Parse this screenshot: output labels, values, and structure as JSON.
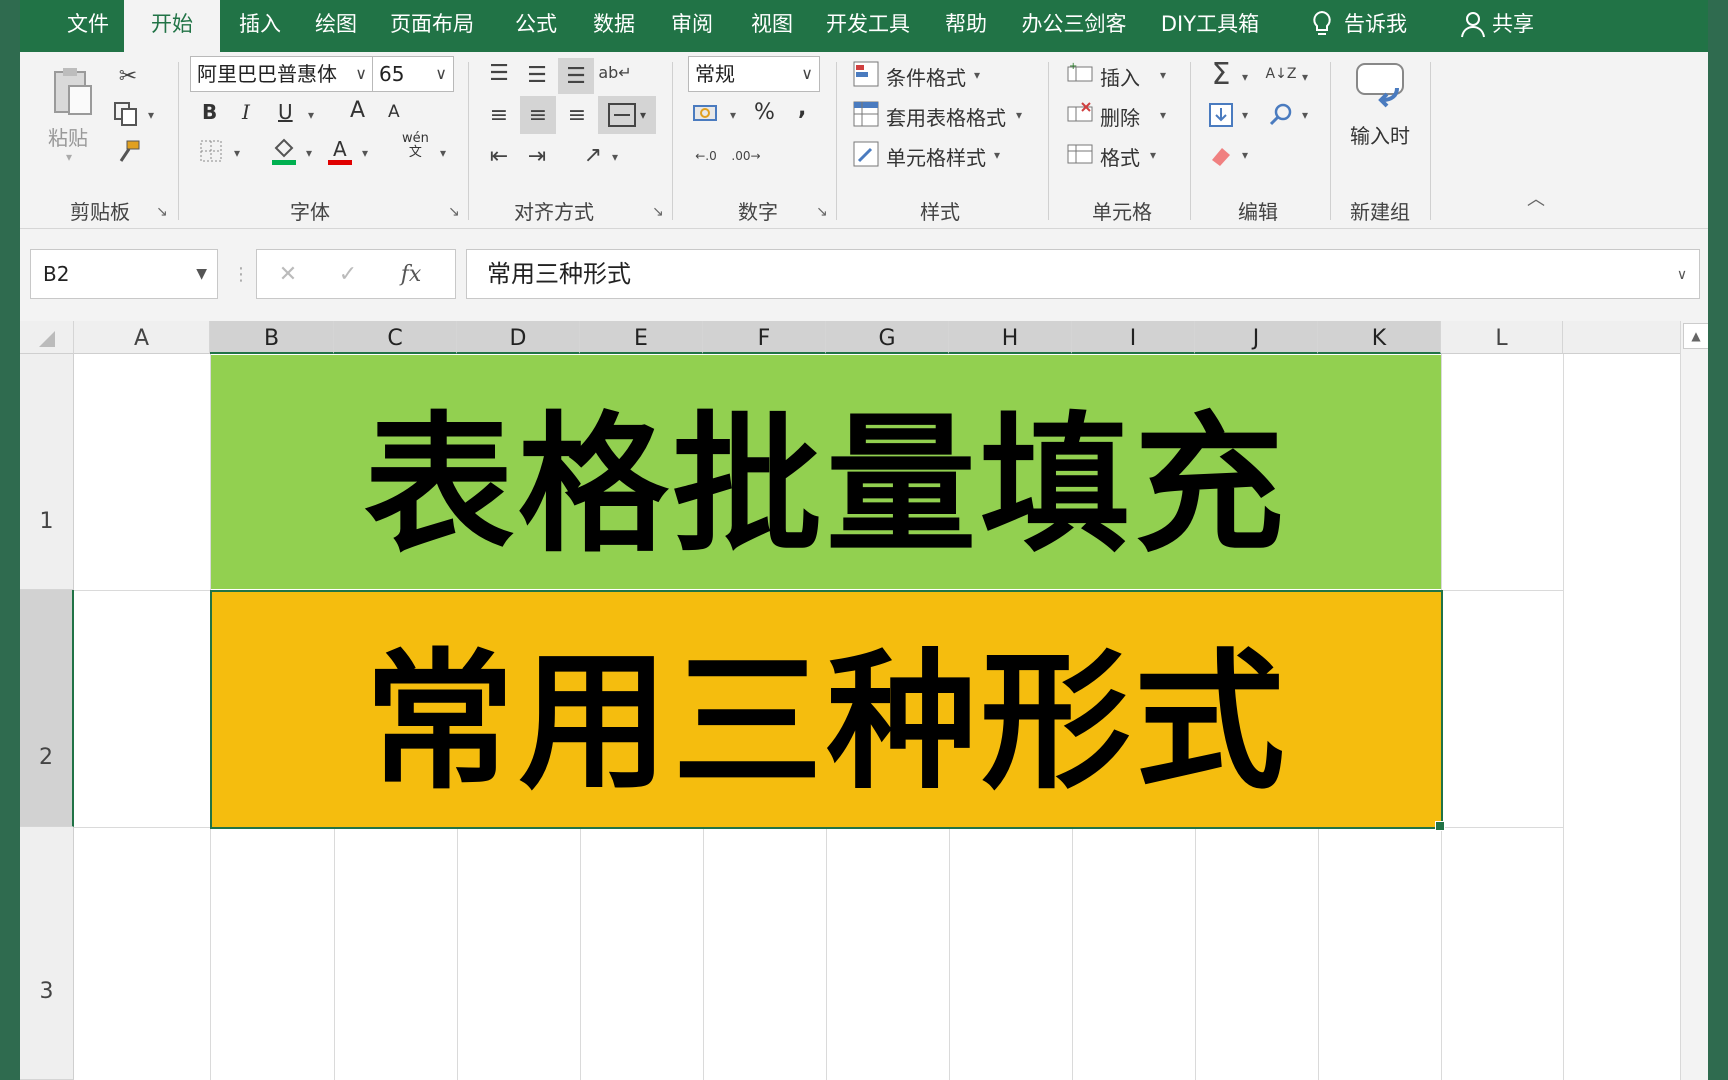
{
  "tabs": [
    "文件",
    "开始",
    "插入",
    "绘图",
    "页面布局",
    "公式",
    "数据",
    "审阅",
    "视图",
    "开发工具",
    "帮助",
    "办公三剑客",
    "DIY工具箱"
  ],
  "tell_me": "告诉我",
  "share": "共享",
  "ribbon": {
    "clipboard": {
      "label": "剪贴板",
      "paste": "粘贴"
    },
    "font": {
      "label": "字体",
      "font_name": "阿里巴巴普惠体",
      "font_size": "65",
      "bold": "B",
      "italic": "I",
      "underline": "U",
      "grow": "A",
      "shrink": "A",
      "phonetic_top": "wén",
      "phonetic_bottom": "文"
    },
    "alignment": {
      "label": "对齐方式"
    },
    "number": {
      "label": "数字",
      "format": "常规",
      "percent": "%",
      "comma": ","
    },
    "styles": {
      "label": "样式",
      "conditional": "条件格式",
      "table": "套用表格格式",
      "cell": "单元格样式"
    },
    "cells": {
      "label": "单元格",
      "insert": "插入",
      "delete": "删除",
      "format": "格式"
    },
    "editing": {
      "label": "编辑"
    },
    "newgroup": {
      "label": "新建组",
      "entry": "输入时"
    }
  },
  "namebox": "B2",
  "formula": "常用三种形式",
  "columns": [
    "A",
    "B",
    "C",
    "D",
    "E",
    "F",
    "G",
    "H",
    "I",
    "J",
    "K",
    "L"
  ],
  "rows": [
    "1",
    "2",
    "3"
  ],
  "cells": {
    "title": "表格批量填充",
    "subtitle": "常用三种形式"
  },
  "colors": {
    "accent": "#217346",
    "title_fill": "#92d050",
    "subtitle_fill": "#f5bd0e"
  }
}
